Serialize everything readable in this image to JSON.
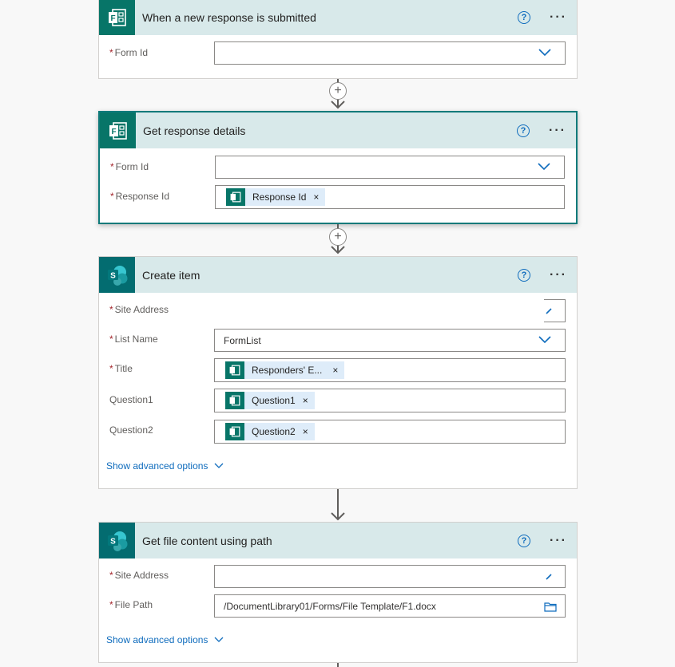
{
  "steps": [
    {
      "title": "When a new response is submitted",
      "icon": "forms-icon",
      "fields": [
        {
          "label": "Form Id",
          "required": true,
          "value": "",
          "type": "dropdown"
        }
      ]
    },
    {
      "title": "Get response details",
      "icon": "forms-icon",
      "fields": [
        {
          "label": "Form Id",
          "required": true,
          "value": "",
          "type": "dropdown"
        },
        {
          "label": "Response Id",
          "required": true,
          "token": "Response Id"
        }
      ]
    },
    {
      "title": "Create item",
      "icon": "sharepoint-icon",
      "fields": [
        {
          "label": "Site Address",
          "required": true,
          "value": ""
        },
        {
          "label": "List Name",
          "required": true,
          "value": "FormList",
          "type": "dropdown"
        },
        {
          "label": "Title",
          "required": true,
          "token": "Responders' E..."
        },
        {
          "label": "Question1",
          "required": false,
          "token": "Question1"
        },
        {
          "label": "Question2",
          "required": false,
          "token": "Question2"
        }
      ],
      "advanced": "Show advanced options"
    },
    {
      "title": "Get file content using path",
      "icon": "sharepoint-icon",
      "fields": [
        {
          "label": "Site Address",
          "required": true,
          "value": ""
        },
        {
          "label": "File Path",
          "required": true,
          "value": "/DocumentLibrary01/Forms/File Template/F1.docx"
        }
      ],
      "advanced": "Show advanced options"
    }
  ],
  "common": {
    "required_mark": "*",
    "help": "?",
    "more": "···",
    "token_remove": "×",
    "plus": "+"
  },
  "colors": {
    "header_bg": "#d8e9ea",
    "forms_green": "#077568",
    "sharepoint_teal": "#036c70",
    "link_blue": "#0f6cbd",
    "required_red": "#a4262c"
  }
}
